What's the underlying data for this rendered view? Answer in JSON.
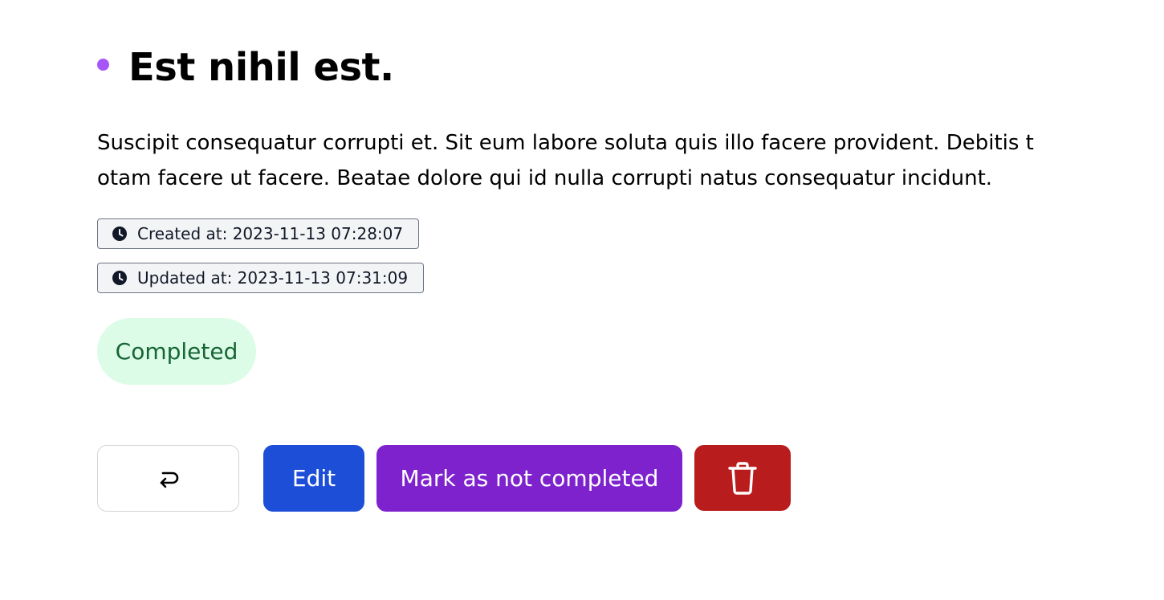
{
  "task": {
    "title": "Est nihil est.",
    "description": "Suscipit consequatur corrupti et. Sit eum labore soluta quis illo facere provident. Debitis totam facere ut facere. Beatae dolore qui id nulla corrupti natus consequatur incidunt.",
    "created_at": "Created at: 2023-11-13 07:28:07",
    "updated_at": "Updated at: 2023-11-13 07:31:09",
    "status": "Completed"
  },
  "actions": {
    "back_icon": "return-arrow-icon",
    "edit_label": "Edit",
    "toggle_label": "Mark as not completed",
    "delete_icon": "trash-icon"
  },
  "colors": {
    "bullet": "#a855f7",
    "status_bg": "#dcfce7",
    "status_text": "#166534",
    "edit": "#1d4ed8",
    "toggle": "#7e22ce",
    "delete": "#b91c1c"
  }
}
